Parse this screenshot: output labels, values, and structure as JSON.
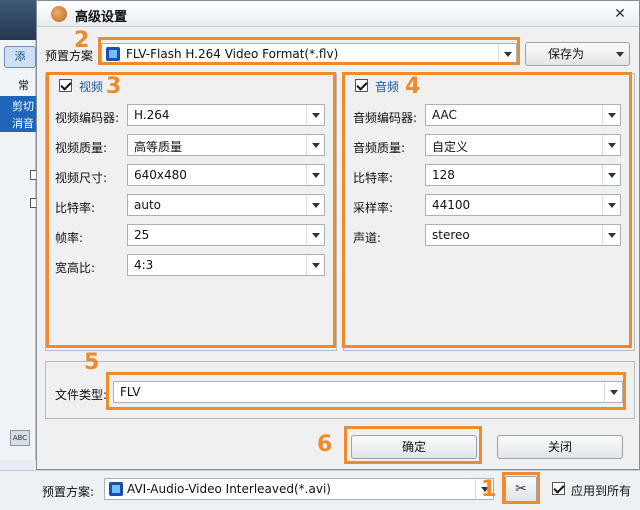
{
  "background": {
    "tab_label": "添",
    "left_labels": [
      "常",
      "剪切",
      "消音"
    ],
    "bottom": {
      "preset_label": "预置方案:",
      "preset_value": "AVI-Audio-Video Interleaved(*.avi)",
      "apply_all_label": "应用到所有",
      "tool_icon": "scissors-wrench-icon"
    }
  },
  "dialog": {
    "title": "高级设置",
    "preset": {
      "label": "预置方案",
      "value": "FLV-Flash H.264 Video Format(*.flv)",
      "save_as_label": "保存为"
    },
    "video": {
      "title": "视频",
      "fields": [
        {
          "label": "视频编码器:",
          "value": "H.264"
        },
        {
          "label": "视频质量:",
          "value": "高等质量"
        },
        {
          "label": "视频尺寸:",
          "value": "640x480"
        },
        {
          "label": "比特率:",
          "value": "auto"
        },
        {
          "label": "帧率:",
          "value": "25"
        },
        {
          "label": "宽高比:",
          "value": "4:3"
        }
      ]
    },
    "audio": {
      "title": "音频",
      "fields": [
        {
          "label": "音频编码器:",
          "value": "AAC"
        },
        {
          "label": "音频质量:",
          "value": "自定义"
        },
        {
          "label": "比特率:",
          "value": "128"
        },
        {
          "label": "采样率:",
          "value": "44100"
        },
        {
          "label": "声道:",
          "value": "stereo"
        }
      ]
    },
    "file_type": {
      "label": "文件类型:",
      "value": "FLV"
    },
    "ok_label": "确定",
    "close_label": "关闭"
  },
  "annotations": [
    "1",
    "2",
    "3",
    "4",
    "5",
    "6"
  ],
  "colors": {
    "highlight": "#f08a2a",
    "group_title": "#1b55b3"
  }
}
